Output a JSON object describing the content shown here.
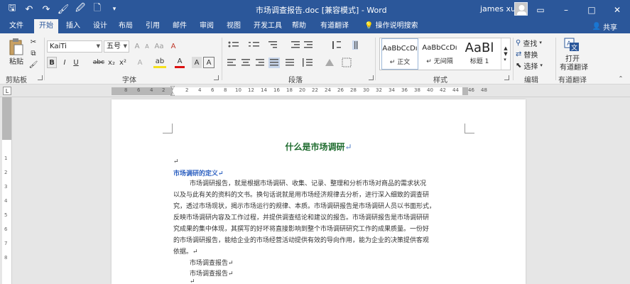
{
  "window": {
    "title": "市场调查报告.doc [兼容模式] - Word",
    "user": "james xu",
    "controls": [
      "▭",
      "–",
      "□",
      "✕"
    ]
  },
  "qat": [
    "🖫",
    "↶",
    "↷",
    "🖌",
    "🖉",
    "🗋",
    "▾"
  ],
  "tabs": [
    "文件",
    "开始",
    "插入",
    "设计",
    "布局",
    "引用",
    "邮件",
    "审阅",
    "视图",
    "开发工具",
    "帮助",
    "有道翻译",
    "操作说明搜索"
  ],
  "share": "共享",
  "ribbon": {
    "clipboard": {
      "paste": "粘贴",
      "label": "剪贴板"
    },
    "font": {
      "name": "KaiTi",
      "size": "五号",
      "label": "字体",
      "row1": [
        "A",
        "A",
        "Aa",
        "A"
      ],
      "row2": [
        "B",
        "I",
        "U",
        "abc",
        "x₂",
        "x²",
        "A",
        "ab",
        "A",
        "A",
        "A"
      ]
    },
    "paragraph": {
      "label": "段落"
    },
    "styles": {
      "label": "样式",
      "items": [
        {
          "preview": "AaBbCcDı",
          "name": "↵ 正文"
        },
        {
          "preview": "AaBbCcDı",
          "name": "↵ 无间隔"
        },
        {
          "preview": "AaBl",
          "name": "标题 1"
        }
      ]
    },
    "editing": {
      "find": "查找",
      "replace": "替换",
      "select": "选择",
      "label": "编辑"
    },
    "youdao": {
      "line1": "打开",
      "line2": "有道翻译",
      "label": "有道翻译"
    }
  },
  "ruler": [
    "8",
    "6",
    "4",
    "2",
    "2",
    "4",
    "6",
    "8",
    "10",
    "12",
    "14",
    "16",
    "18",
    "20",
    "22",
    "24",
    "26",
    "28",
    "30",
    "32",
    "34",
    "36",
    "38",
    "40",
    "42",
    "44",
    "46",
    "48"
  ],
  "vruler": [
    "1",
    "2",
    "3",
    "4",
    "5",
    "6",
    "7",
    "8"
  ],
  "document": {
    "heading": "什么是市场调研",
    "pmark": "↵",
    "blank": "↵",
    "subtitle": "市场调研的定义↵",
    "lines": [
      "市场调研报告，就是根据市场调研、收集、记录、整理和分析市场对商品的需求状况",
      "以及与此有关的资料的文书。换句话说就是用市场经济规律去分析，进行深入细致的调查研",
      "究，透过市场现状，揭示市场运行的规律、本质。市场调研报告是市场调研人员以书面形式，",
      "反映市场调研内容及工作过程，并提供调查结论和建议的报告。市场调研报告是市场调研研",
      "究成果的集中体现，其撰写的好坏将直接影响到整个市场调研研究工作的成果质量。一份好",
      "的市场调研报告，能给企业的市场经营活动提供有效的导向作用，能为企业的决策提供客观",
      "依据。↵"
    ],
    "items": [
      "市场调查报告↵",
      "市场调查报告↵",
      "↵"
    ]
  }
}
